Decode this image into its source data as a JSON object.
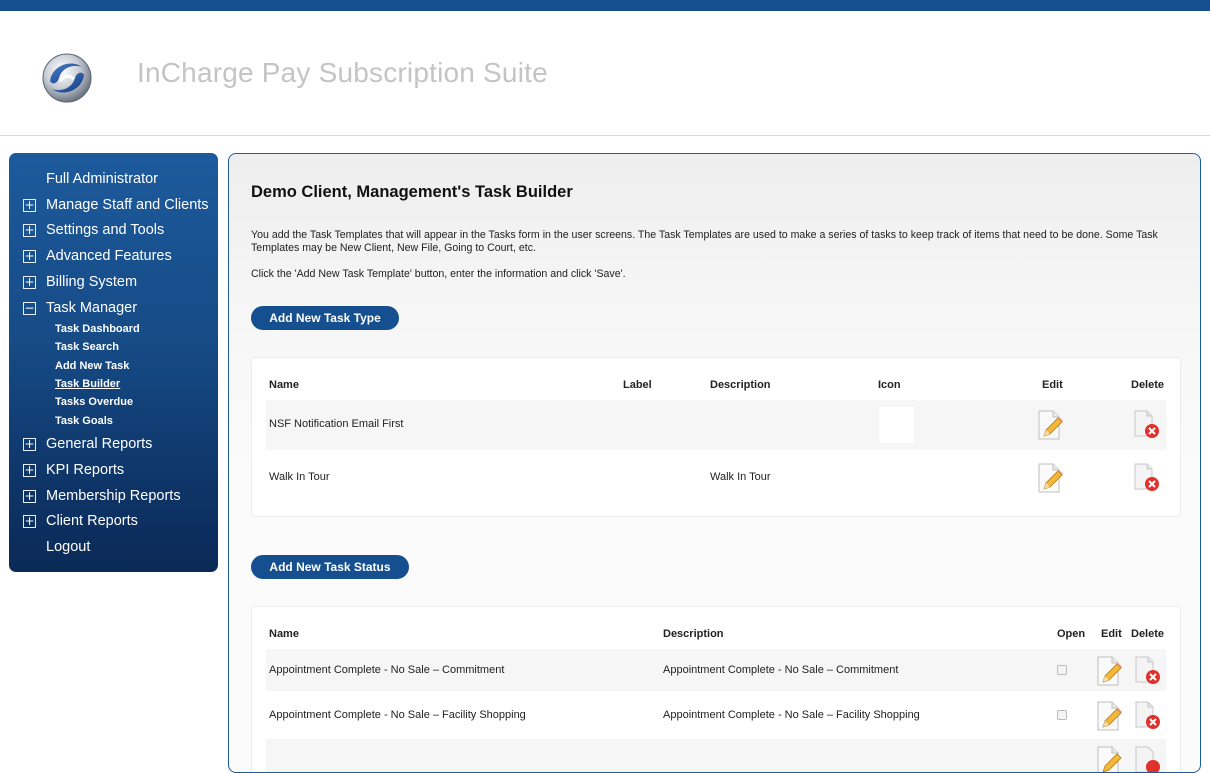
{
  "header": {
    "title": "InCharge Pay Subscription Suite",
    "logo_icon": "swirl-logo-icon"
  },
  "sidebar": {
    "items": [
      {
        "label": "Full Administrator",
        "toggle": ""
      },
      {
        "label": "Manage Staff and Clients",
        "toggle": "+"
      },
      {
        "label": "Settings and Tools",
        "toggle": "+"
      },
      {
        "label": "Advanced Features",
        "toggle": "+"
      },
      {
        "label": "Billing System",
        "toggle": "+"
      },
      {
        "label": "Task Manager",
        "toggle": "−"
      },
      {
        "label": "General Reports",
        "toggle": "+"
      },
      {
        "label": "KPI Reports",
        "toggle": "+"
      },
      {
        "label": "Membership Reports",
        "toggle": "+"
      },
      {
        "label": "Client Reports",
        "toggle": "+"
      },
      {
        "label": "Logout",
        "toggle": ""
      }
    ],
    "task_manager_subitems": [
      {
        "label": "Task Dashboard"
      },
      {
        "label": "Task Search"
      },
      {
        "label": "Add New Task"
      },
      {
        "label": "Task Builder",
        "active": true
      },
      {
        "label": "Tasks Overdue"
      },
      {
        "label": "Task Goals"
      }
    ]
  },
  "main": {
    "title": "Demo Client, Management's Task Builder",
    "intro": "You add the Task Templates that will appear in the Tasks form in the user screens. The Task Templates are used to make a series of tasks to keep track of items that need to be done. Some Task Templates may be New Client, New File, Going to Court, etc.",
    "instruction": "Click the 'Add New Task Template' button, enter the information and click 'Save'.",
    "add_task_type_label": "Add New Task Type",
    "add_task_status_label": "Add New Task Status",
    "task_types": {
      "headers": {
        "name": "Name",
        "label": "Label",
        "description": "Description",
        "icon": "Icon",
        "edit": "Edit",
        "delete": "Delete"
      },
      "rows": [
        {
          "name": "NSF Notification Email First",
          "label": "",
          "description": ""
        },
        {
          "name": "Walk In Tour",
          "label": "",
          "description": "Walk In Tour"
        }
      ]
    },
    "task_statuses": {
      "headers": {
        "name": "Name",
        "description": "Description",
        "open": "Open",
        "edit": "Edit",
        "delete": "Delete"
      },
      "rows": [
        {
          "name": "Appointment Complete - No Sale – Commitment",
          "description": "Appointment Complete - No Sale – Commitment",
          "open": false
        },
        {
          "name": "Appointment Complete - No Sale – Facility Shopping",
          "description": "Appointment Complete - No Sale – Facility Shopping",
          "open": false
        },
        {
          "name": "",
          "description": "",
          "open": false
        }
      ]
    }
  },
  "colors": {
    "brand": "#154f8f",
    "sidebar_top": "#1d5a9c",
    "sidebar_bottom": "#0b2a57",
    "title_gray": "#c4c4c4",
    "delete_red": "#e0312c"
  }
}
